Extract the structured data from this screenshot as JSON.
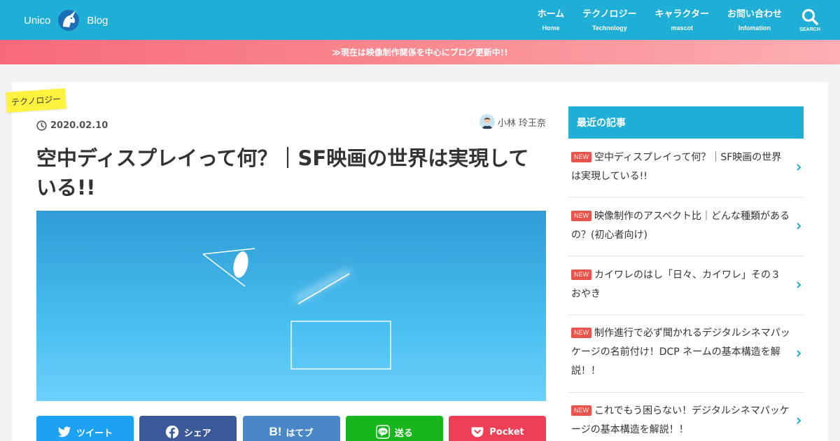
{
  "header": {
    "logo_left": "Unico",
    "logo_right": "Blog",
    "nav": [
      {
        "label": "ホーム",
        "sub": "Home"
      },
      {
        "label": "テクノロジー",
        "sub": "Technology"
      },
      {
        "label": "キャラクター",
        "sub": "mascot"
      },
      {
        "label": "お問い合わせ",
        "sub": "Infomation"
      }
    ],
    "search_label": "SEARCH"
  },
  "notice": "≫現在は映像制作関係を中心にブログ更新中!!",
  "article": {
    "category": "テクノロジー",
    "date": "2020.02.10",
    "author": "小林 玲王奈",
    "title": "空中ディスプレイって何？｜SF映画の世界は実現している!!"
  },
  "share": {
    "twitter": "ツイート",
    "facebook": "シェア",
    "hatena_mark": "B!",
    "hatena": "はてブ",
    "line": "送る",
    "pocket": "Pocket"
  },
  "sidebar": {
    "heading": "最近の記事",
    "new_label": "NEW",
    "items": [
      {
        "title": "空中ディスプレイって何？｜SF映画の世界は実現している!!"
      },
      {
        "title": "映像制作のアスペクト比｜どんな種類があるの？(初心者向け)"
      },
      {
        "title": "カイワレのはし「日々、カイワレ」その３ おやき"
      },
      {
        "title": "制作進行で必ず聞かれるデジタルシネマパッケージの名前付け！DCP ネームの基本構造を解説！！"
      },
      {
        "title": "これでもう困らない！デジタルシネマパッケージの基本構造を解説！！"
      }
    ]
  },
  "colors": {
    "header": "#1eaed6",
    "notice_start": "#f7697a",
    "notice_end": "#fcaeb2",
    "category_tag": "#fff33f",
    "new_badge": "#e9544a"
  }
}
